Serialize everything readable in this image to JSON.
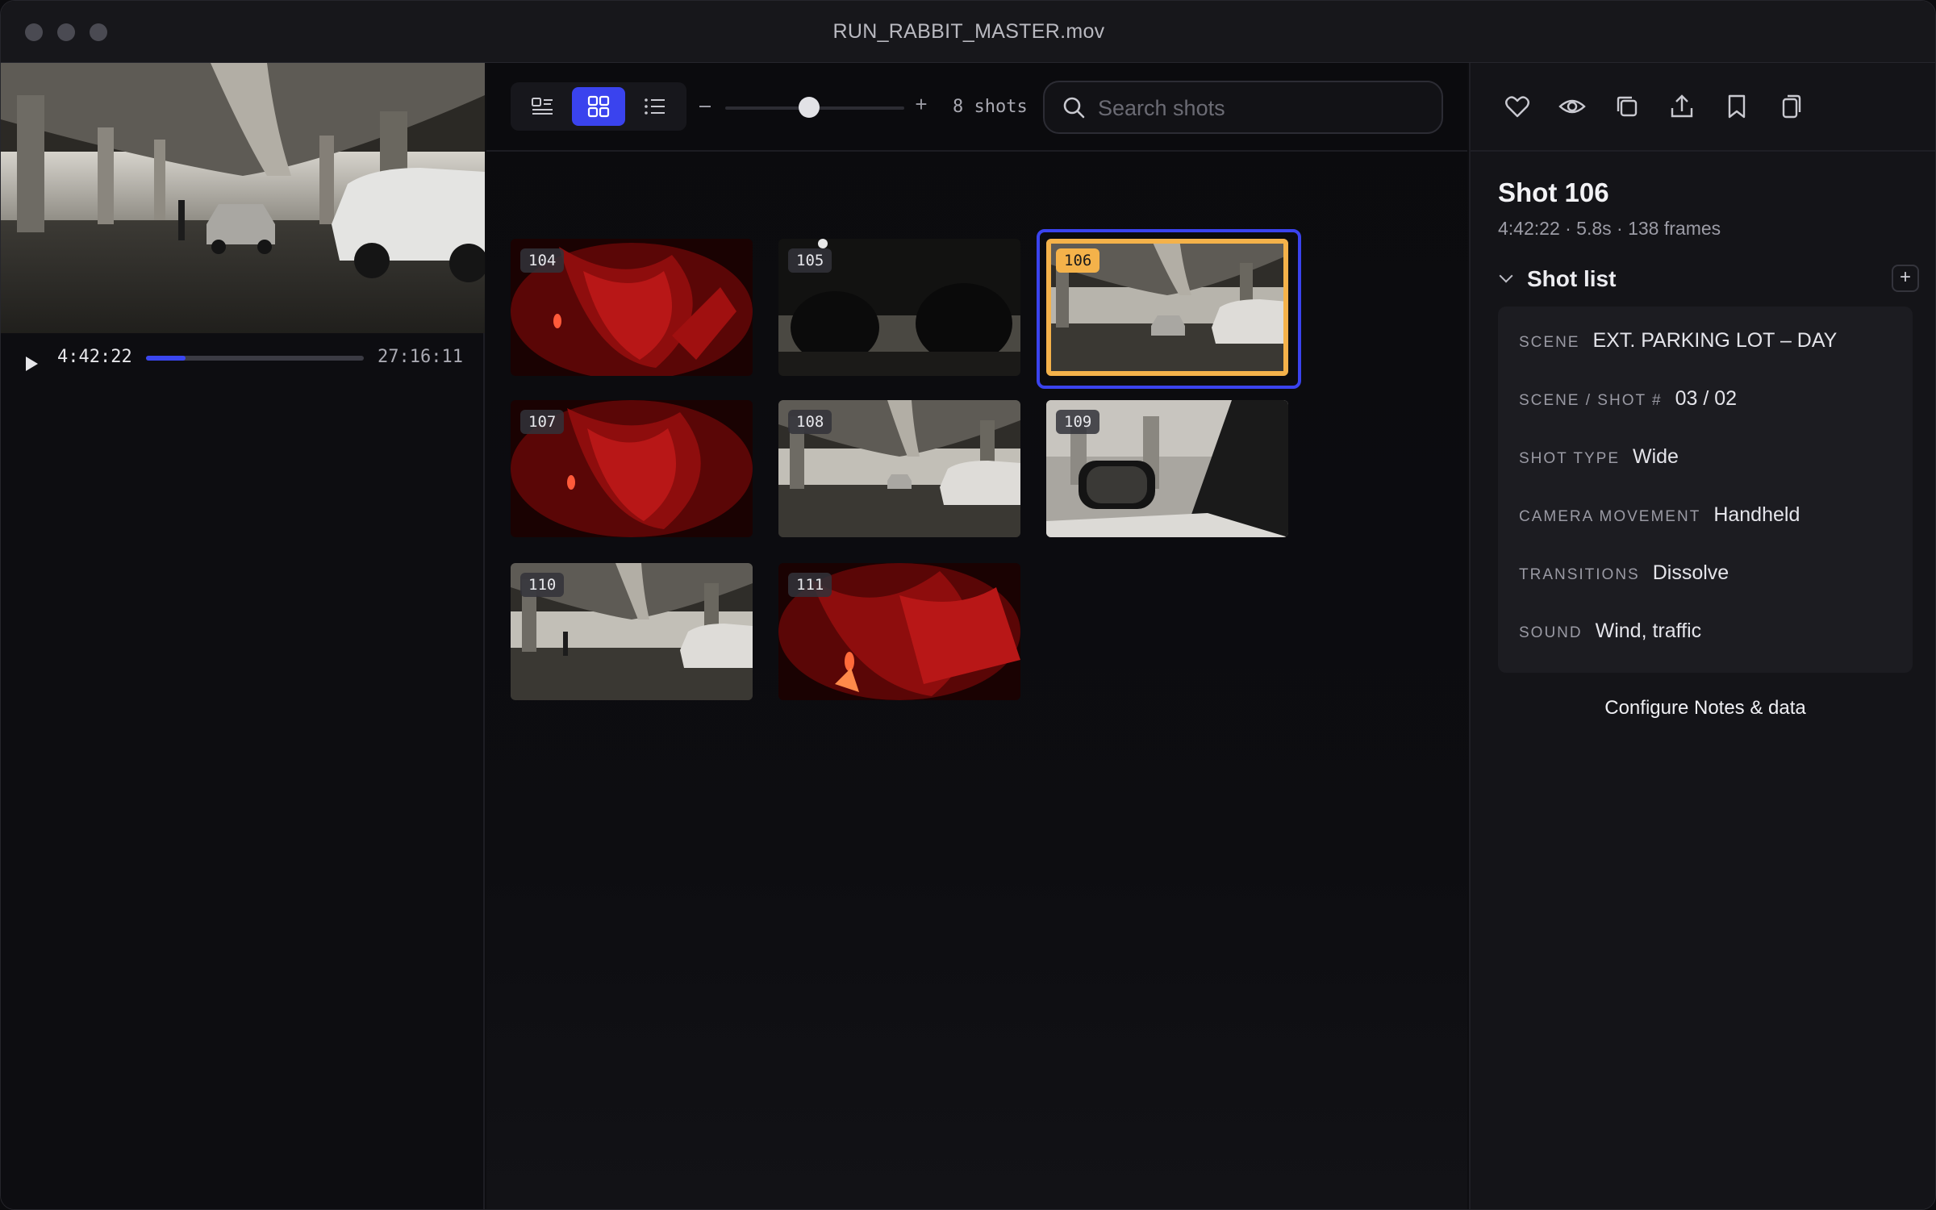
{
  "window": {
    "title": "RUN_RABBIT_MASTER.mov"
  },
  "player": {
    "current_tc": "4:42:22",
    "duration_tc": "27:16:11",
    "progress": 0.18
  },
  "toolbar": {
    "views": [
      "detail-list-view",
      "grid-view",
      "list-view"
    ],
    "active_view": "grid-view",
    "zoom_level": 0.47,
    "shot_count": "8 shots",
    "search_placeholder": "Search shots"
  },
  "shots": [
    {
      "id": "104",
      "style": "red"
    },
    {
      "id": "105",
      "style": "dark"
    },
    {
      "id": "106",
      "style": "lot",
      "selected": true
    },
    {
      "id": "107",
      "style": "red"
    },
    {
      "id": "108",
      "style": "lot"
    },
    {
      "id": "109",
      "style": "mirror"
    },
    {
      "id": "110",
      "style": "lot"
    },
    {
      "id": "111",
      "style": "red"
    }
  ],
  "panel": {
    "icons": [
      "heart-icon",
      "eye-icon",
      "copy-icon",
      "share-icon",
      "bookmark-icon",
      "duplicate-icon"
    ],
    "title": "Shot 106",
    "meta": "4:42:22 · 5.8s · 138 frames",
    "section_label": "Shot list",
    "fields": [
      {
        "key": "Scene",
        "value": "EXT. PARKING LOT – DAY"
      },
      {
        "key": "Scene / Shot #",
        "value": "03 / 02"
      },
      {
        "key": "Shot type",
        "value": "Wide"
      },
      {
        "key": "Camera movement",
        "value": "Handheld"
      },
      {
        "key": "Transitions",
        "value": "Dissolve"
      },
      {
        "key": "Sound",
        "value": "Wind, traffic"
      }
    ],
    "configure_label": "Configure Notes & data"
  },
  "colors": {
    "accent": "#3a43ee",
    "selection": "#f4b24a",
    "background": "#0d0d10"
  }
}
